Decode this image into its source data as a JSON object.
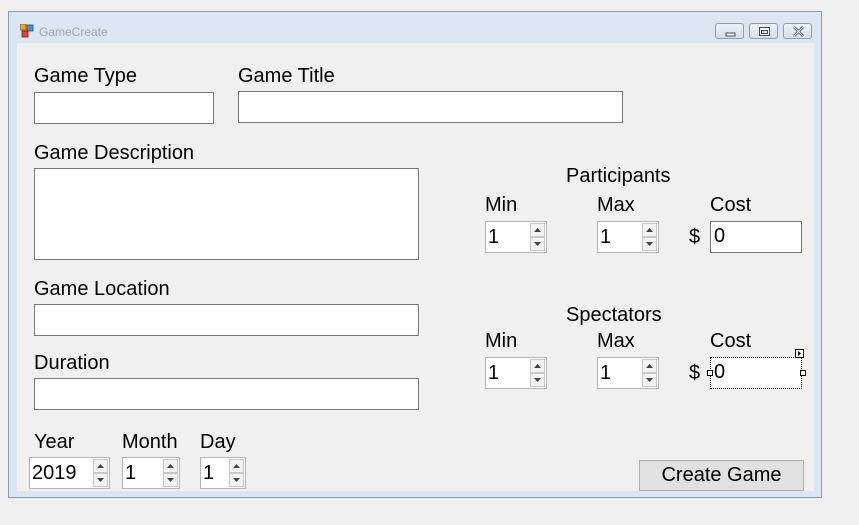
{
  "window": {
    "title": "GameCreate",
    "controls": [
      "minimize-icon",
      "maximize-icon",
      "close-icon"
    ]
  },
  "form": {
    "game_type_label": "Game Type",
    "game_type_value": "",
    "game_title_label": "Game Title",
    "game_title_value": "",
    "game_description_label": "Game Description",
    "game_description_value": "",
    "game_location_label": "Game Location",
    "game_location_value": "",
    "duration_label": "Duration",
    "duration_value": "",
    "year_label": "Year",
    "year_value": "2019",
    "month_label": "Month",
    "month_value": "1",
    "day_label": "Day",
    "day_value": "1",
    "create_button_label": "Create Game"
  },
  "participants": {
    "heading": "Participants",
    "min_label": "Min",
    "min_value": "1",
    "max_label": "Max",
    "max_value": "1",
    "cost_label": "Cost",
    "currency_symbol": "$",
    "cost_value": "0"
  },
  "spectators": {
    "heading": "Spectators",
    "min_label": "Min",
    "min_value": "1",
    "max_label": "Max",
    "max_value": "1",
    "cost_label": "Cost",
    "currency_symbol": "$",
    "cost_value": "0"
  }
}
